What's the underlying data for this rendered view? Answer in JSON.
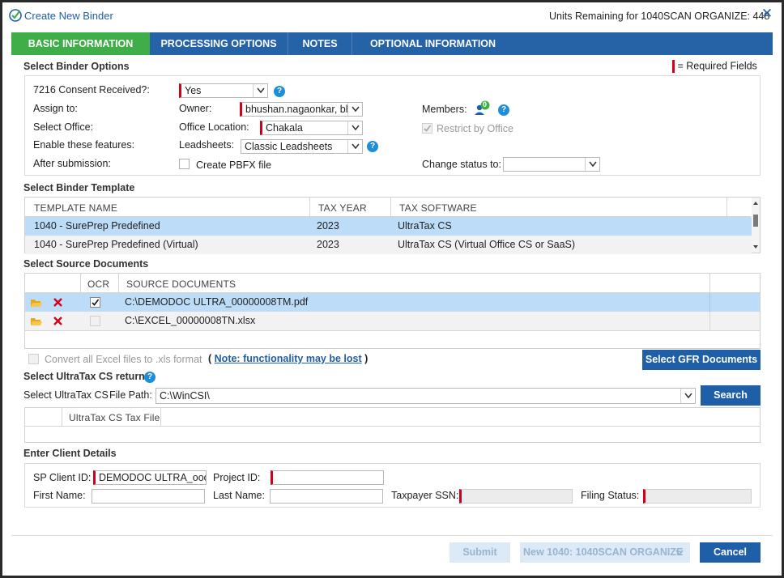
{
  "window": {
    "title": "Create New Binder",
    "units_remaining": "Units Remaining for 1040SCAN ORGANIZE: 448"
  },
  "tabs": [
    {
      "label": "BASIC INFORMATION"
    },
    {
      "label": "PROCESSING OPTIONS"
    },
    {
      "label": "NOTES"
    },
    {
      "label": "OPTIONAL INFORMATION"
    }
  ],
  "binder_options": {
    "section_title": "Select Binder Options",
    "required_legend": "= Required Fields",
    "consent_label": "7216 Consent Received?:",
    "consent_value": "Yes",
    "assign_label": "Assign to:",
    "owner_label": "Owner:",
    "owner_value": "bhushan.nagaonkar, bh",
    "members_label": "Members:",
    "members_count": "0",
    "office_label": "Select Office:",
    "office_location_label": "Office Location:",
    "office_location_value": "Chakala",
    "restrict_label": "Restrict by Office",
    "features_label": "Enable these features:",
    "leadsheets_label": "Leadsheets:",
    "leadsheets_value": "Classic Leadsheets",
    "after_label": "After submission:",
    "pbfx_label": "Create PBFX file",
    "change_status_label": "Change status to:",
    "change_status_value": ""
  },
  "template": {
    "section_title": "Select Binder Template",
    "headers": [
      "TEMPLATE NAME",
      "TAX YEAR",
      "TAX SOFTWARE"
    ],
    "rows": [
      {
        "name": "1040 - SurePrep Predefined",
        "year": "2023",
        "software": "UltraTax CS"
      },
      {
        "name": "1040 - SurePrep Predefined (Virtual)",
        "year": "2023",
        "software": "UltraTax CS (Virtual Office CS or SaaS)"
      }
    ]
  },
  "source_docs": {
    "section_title": "Select Source Documents",
    "headers": [
      "OCR",
      "SOURCE DOCUMENTS"
    ],
    "rows": [
      {
        "path": "C:\\DEMODOC ULTRA_00000008TM.pdf",
        "ocr": true
      },
      {
        "path": "C:\\EXCEL_00000008TN.xlsx",
        "ocr": false
      }
    ],
    "convert_label": "Convert all Excel files to .xls format",
    "note_open": "(",
    "note_link": "Note: functionality may be lost",
    "note_close": ")",
    "gfr_button": "Select GFR Documents"
  },
  "ultratax": {
    "section_title": "Select UltraTax CS return",
    "select_label": "Select UltraTax CS",
    "file_path_label": "File Path:",
    "file_path_value": "C:\\WinCSI\\",
    "search_button": "Search",
    "column": "UltraTax CS Tax File"
  },
  "client": {
    "section_title": "Enter Client Details",
    "sp_client_label": "SP Client ID:",
    "sp_client_value": "DEMODOC ULTRA_oooo",
    "project_label": "Project ID:",
    "project_value": "",
    "first_label": "First Name:",
    "last_label": "Last Name:",
    "ssn_label": "Taxpayer SSN:",
    "filing_label": "Filing Status:"
  },
  "footer": {
    "submit": "Submit",
    "new_product": "New 1040: 1040SCAN ORGANIZE",
    "cancel": "Cancel"
  },
  "colors": {
    "tab_bar": "#2563a6",
    "tab_active": "#3fae48",
    "required": "#d0021b",
    "selection": "#bcdcf8",
    "button": "#1f5fa8"
  }
}
